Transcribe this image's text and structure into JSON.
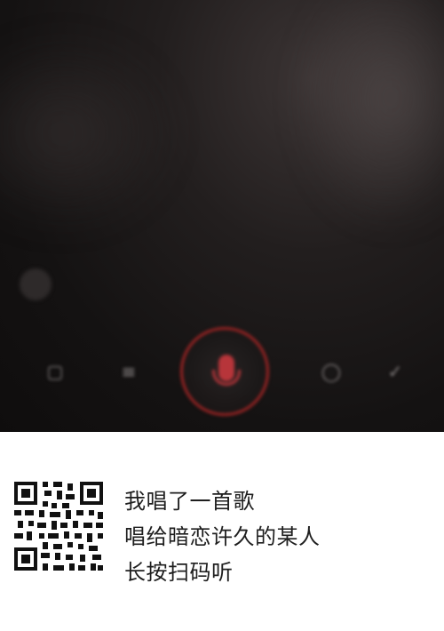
{
  "hero": {
    "lyrics": [
      "",
      "",
      "",
      "",
      ""
    ],
    "controls": [
      {
        "icon": "box-icon",
        "label": ""
      },
      {
        "icon": "bars-icon",
        "label": ""
      },
      {
        "icon": "chat-icon",
        "label": ""
      },
      {
        "icon": "check-icon",
        "label": ""
      }
    ]
  },
  "share_card": {
    "line1": "我唱了一首歌",
    "line2": "唱给暗恋许久的某人",
    "line3": "长按扫码听"
  },
  "colors": {
    "record_ring": "#c82828",
    "mic": "#b7353a",
    "card_bg": "#ffffff",
    "text": "#1e1e1e"
  }
}
